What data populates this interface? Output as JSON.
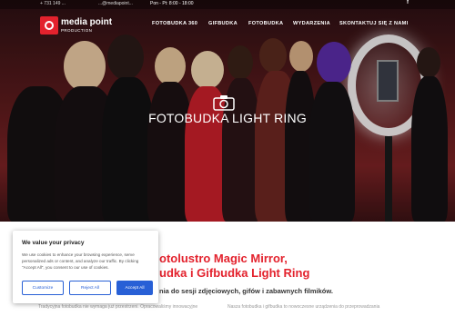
{
  "topbar": {
    "phone": "+ 731 149 ...",
    "email": "...@mediapoint...",
    "hours": "Pon - Pt: 8:00 - 18:00",
    "facebook_icon": "f"
  },
  "logo": {
    "name": "media point",
    "sub": "PRODUCTION"
  },
  "nav": {
    "items": [
      {
        "label": "FOTOBUDKA 360"
      },
      {
        "label": "GIFBUDKA"
      },
      {
        "label": "FOTOBUDKA"
      },
      {
        "label": "WYDARZENIA"
      },
      {
        "label": "SKONTAKTUJ SIĘ Z NAMI"
      }
    ]
  },
  "hero": {
    "title": "FOTOBUDKA LIGHT RING",
    "camera_icon": "camera-icon"
  },
  "content": {
    "headline_line1": "otolustro Magic Mirror,",
    "headline_line2": "udka i Gifbudka Light Ring",
    "subline": "nia do sesji zdjęciowych, gifów i zabawnych filmików.",
    "para_left": "Tradycyjna fotobudka nie wymaga już przestrzeni. Opracowaliśmy innowacyjne",
    "para_right": "Nasza fotobudka i gifbudka to nowoczesne urządzenia do przeprowadzania"
  },
  "cookie": {
    "title": "We value your privacy",
    "text": "We use cookies to enhance your browsing experience, serve personalized ads or content, and analyze our traffic. By clicking \"Accept All\", you consent to our use of cookies.",
    "customize": "Customize",
    "reject": "Reject All",
    "accept": "Accept All"
  },
  "colors": {
    "brand_red": "#e3222d",
    "button_blue": "#2860d6"
  }
}
